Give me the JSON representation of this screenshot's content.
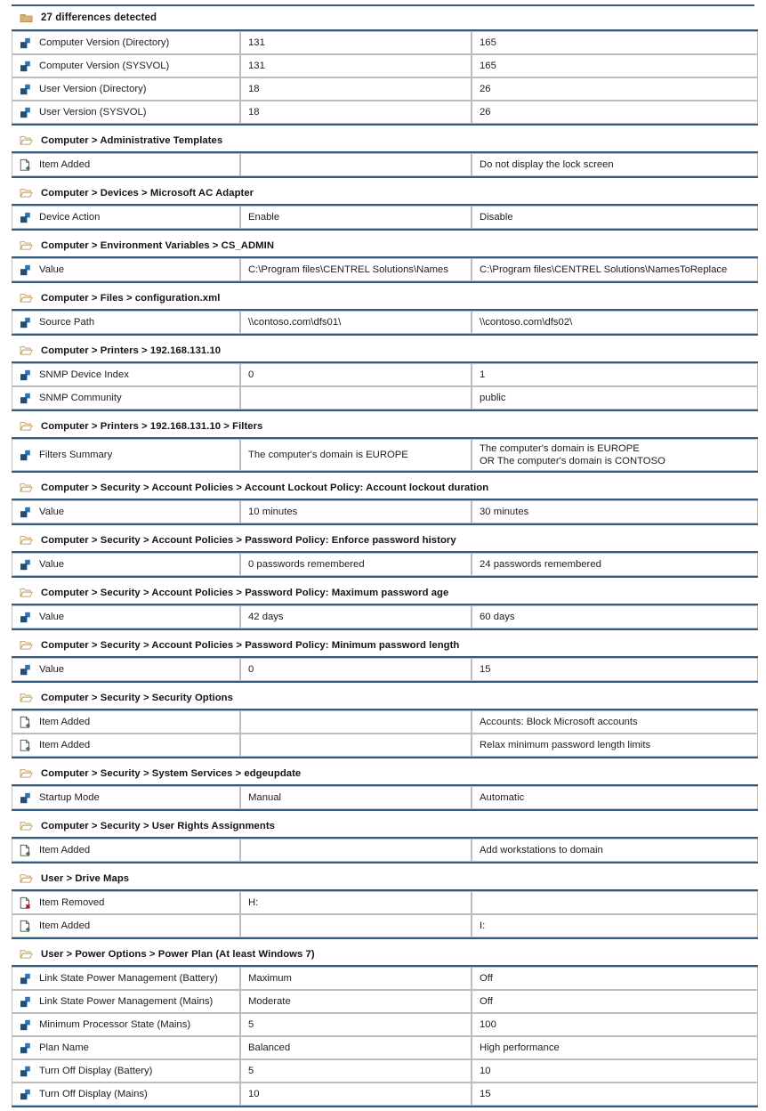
{
  "report": {
    "title": "27 differences detected",
    "title_icon": "folder-closed-icon",
    "colors": {
      "rule": "#2f5d8a",
      "folder": "#c8a46a",
      "node_blue_dark": "#1f4e79",
      "node_blue_light": "#2e75b6",
      "added_green": "#2e8b2e",
      "removed_red": "#c00000",
      "cell_border": "#bdbdbd"
    },
    "sections": [
      {
        "heading": null,
        "rows": [
          {
            "icon": "gpo-node-icon",
            "name": "Computer Version (Directory)",
            "value_a": "131",
            "value_b": "165"
          },
          {
            "icon": "gpo-node-icon",
            "name": "Computer Version (SYSVOL)",
            "value_a": "131",
            "value_b": "165"
          },
          {
            "icon": "gpo-node-icon",
            "name": "User Version (Directory)",
            "value_a": "18",
            "value_b": "26"
          },
          {
            "icon": "gpo-node-icon",
            "name": "User Version (SYSVOL)",
            "value_a": "18",
            "value_b": "26"
          }
        ]
      },
      {
        "heading": "Computer > Administrative Templates",
        "rows": [
          {
            "icon": "item-added-icon",
            "name": "Item Added",
            "value_a": "",
            "value_b": "Do not display the lock screen"
          }
        ]
      },
      {
        "heading": "Computer > Devices > Microsoft AC Adapter",
        "rows": [
          {
            "icon": "gpo-node-icon",
            "name": "Device Action",
            "value_a": "Enable",
            "value_b": "Disable"
          }
        ]
      },
      {
        "heading": "Computer > Environment Variables > CS_ADMIN",
        "rows": [
          {
            "icon": "gpo-node-icon",
            "name": "Value",
            "value_a": "C:\\Program files\\CENTREL Solutions\\Names",
            "value_b": "C:\\Program files\\CENTREL Solutions\\NamesToReplace"
          }
        ]
      },
      {
        "heading": "Computer > Files > configuration.xml",
        "rows": [
          {
            "icon": "gpo-node-icon",
            "name": "Source Path",
            "value_a": "\\\\contoso.com\\dfs01\\",
            "value_b": "\\\\contoso.com\\dfs02\\"
          }
        ]
      },
      {
        "heading": "Computer > Printers > 192.168.131.10",
        "rows": [
          {
            "icon": "gpo-node-icon",
            "name": "SNMP Device Index",
            "value_a": "0",
            "value_b": "1"
          },
          {
            "icon": "gpo-node-icon",
            "name": "SNMP Community",
            "value_a": "",
            "value_b": "public"
          }
        ]
      },
      {
        "heading": "Computer > Printers > 192.168.131.10 > Filters",
        "rows": [
          {
            "icon": "gpo-node-icon",
            "name": "Filters Summary",
            "value_a": "The computer's domain is EUROPE",
            "value_b": "The computer's domain is EUROPE\nOR The computer's domain is CONTOSO"
          }
        ]
      },
      {
        "heading": "Computer > Security > Account Policies > Account Lockout Policy: Account lockout duration",
        "rows": [
          {
            "icon": "gpo-node-icon",
            "name": "Value",
            "value_a": "10 minutes",
            "value_b": "30 minutes"
          }
        ]
      },
      {
        "heading": "Computer > Security > Account Policies > Password Policy: Enforce password history",
        "rows": [
          {
            "icon": "gpo-node-icon",
            "name": "Value",
            "value_a": "0 passwords remembered",
            "value_b": "24 passwords remembered"
          }
        ]
      },
      {
        "heading": "Computer > Security > Account Policies > Password Policy: Maximum password age",
        "rows": [
          {
            "icon": "gpo-node-icon",
            "name": "Value",
            "value_a": "42 days",
            "value_b": "60 days"
          }
        ]
      },
      {
        "heading": "Computer > Security > Account Policies > Password Policy: Minimum password length",
        "rows": [
          {
            "icon": "gpo-node-icon",
            "name": "Value",
            "value_a": "0",
            "value_b": "15"
          }
        ]
      },
      {
        "heading": "Computer > Security > Security Options",
        "rows": [
          {
            "icon": "item-added-icon",
            "name": "Item Added",
            "value_a": "",
            "value_b": "Accounts: Block Microsoft accounts"
          },
          {
            "icon": "item-added-icon",
            "name": "Item Added",
            "value_a": "",
            "value_b": "Relax minimum password length limits"
          }
        ]
      },
      {
        "heading": "Computer > Security > System Services > edgeupdate",
        "rows": [
          {
            "icon": "gpo-node-icon",
            "name": "Startup Mode",
            "value_a": "Manual",
            "value_b": "Automatic"
          }
        ]
      },
      {
        "heading": "Computer > Security > User Rights Assignments",
        "rows": [
          {
            "icon": "item-added-icon",
            "name": "Item Added",
            "value_a": "",
            "value_b": "Add workstations to domain"
          }
        ]
      },
      {
        "heading": "User > Drive Maps",
        "rows": [
          {
            "icon": "item-removed-icon",
            "name": "Item Removed",
            "value_a": "H:",
            "value_b": ""
          },
          {
            "icon": "item-added-icon",
            "name": "Item Added",
            "value_a": "",
            "value_b": "I:"
          }
        ]
      },
      {
        "heading": "User > Power Options > Power Plan (At least Windows 7)",
        "rows": [
          {
            "icon": "gpo-node-icon",
            "name": "Link State Power Management (Battery)",
            "value_a": "Maximum",
            "value_b": "Off"
          },
          {
            "icon": "gpo-node-icon",
            "name": "Link State Power Management (Mains)",
            "value_a": "Moderate",
            "value_b": "Off"
          },
          {
            "icon": "gpo-node-icon",
            "name": "Minimum Processor State (Mains)",
            "value_a": "5",
            "value_b": "100"
          },
          {
            "icon": "gpo-node-icon",
            "name": "Plan Name",
            "value_a": "Balanced",
            "value_b": "High performance"
          },
          {
            "icon": "gpo-node-icon",
            "name": "Turn Off Display (Battery)",
            "value_a": "5",
            "value_b": "10"
          },
          {
            "icon": "gpo-node-icon",
            "name": "Turn Off Display (Mains)",
            "value_a": "10",
            "value_b": "15"
          }
        ]
      }
    ]
  }
}
